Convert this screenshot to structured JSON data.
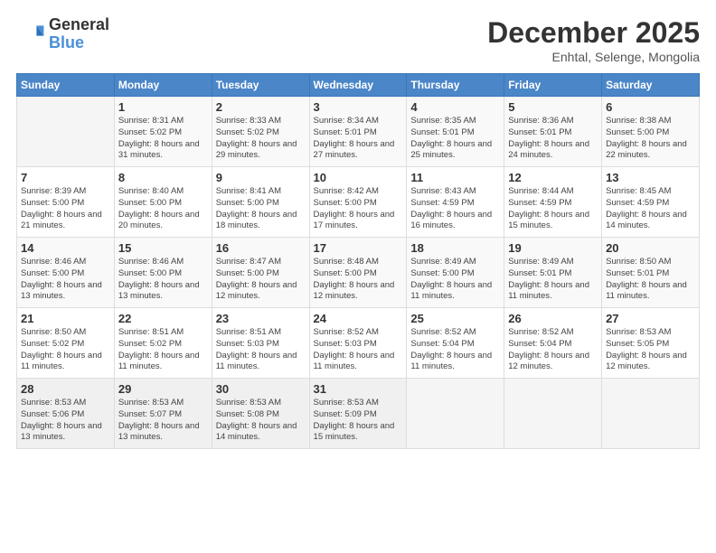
{
  "logo": {
    "general": "General",
    "blue": "Blue"
  },
  "header": {
    "month": "December 2025",
    "location": "Enhtal, Selenge, Mongolia"
  },
  "weekdays": [
    "Sunday",
    "Monday",
    "Tuesday",
    "Wednesday",
    "Thursday",
    "Friday",
    "Saturday"
  ],
  "weeks": [
    [
      {
        "day": "",
        "sunrise": "",
        "sunset": "",
        "daylight": ""
      },
      {
        "day": "1",
        "sunrise": "Sunrise: 8:31 AM",
        "sunset": "Sunset: 5:02 PM",
        "daylight": "Daylight: 8 hours and 31 minutes."
      },
      {
        "day": "2",
        "sunrise": "Sunrise: 8:33 AM",
        "sunset": "Sunset: 5:02 PM",
        "daylight": "Daylight: 8 hours and 29 minutes."
      },
      {
        "day": "3",
        "sunrise": "Sunrise: 8:34 AM",
        "sunset": "Sunset: 5:01 PM",
        "daylight": "Daylight: 8 hours and 27 minutes."
      },
      {
        "day": "4",
        "sunrise": "Sunrise: 8:35 AM",
        "sunset": "Sunset: 5:01 PM",
        "daylight": "Daylight: 8 hours and 25 minutes."
      },
      {
        "day": "5",
        "sunrise": "Sunrise: 8:36 AM",
        "sunset": "Sunset: 5:01 PM",
        "daylight": "Daylight: 8 hours and 24 minutes."
      },
      {
        "day": "6",
        "sunrise": "Sunrise: 8:38 AM",
        "sunset": "Sunset: 5:00 PM",
        "daylight": "Daylight: 8 hours and 22 minutes."
      }
    ],
    [
      {
        "day": "7",
        "sunrise": "Sunrise: 8:39 AM",
        "sunset": "Sunset: 5:00 PM",
        "daylight": "Daylight: 8 hours and 21 minutes."
      },
      {
        "day": "8",
        "sunrise": "Sunrise: 8:40 AM",
        "sunset": "Sunset: 5:00 PM",
        "daylight": "Daylight: 8 hours and 20 minutes."
      },
      {
        "day": "9",
        "sunrise": "Sunrise: 8:41 AM",
        "sunset": "Sunset: 5:00 PM",
        "daylight": "Daylight: 8 hours and 18 minutes."
      },
      {
        "day": "10",
        "sunrise": "Sunrise: 8:42 AM",
        "sunset": "Sunset: 5:00 PM",
        "daylight": "Daylight: 8 hours and 17 minutes."
      },
      {
        "day": "11",
        "sunrise": "Sunrise: 8:43 AM",
        "sunset": "Sunset: 4:59 PM",
        "daylight": "Daylight: 8 hours and 16 minutes."
      },
      {
        "day": "12",
        "sunrise": "Sunrise: 8:44 AM",
        "sunset": "Sunset: 4:59 PM",
        "daylight": "Daylight: 8 hours and 15 minutes."
      },
      {
        "day": "13",
        "sunrise": "Sunrise: 8:45 AM",
        "sunset": "Sunset: 4:59 PM",
        "daylight": "Daylight: 8 hours and 14 minutes."
      }
    ],
    [
      {
        "day": "14",
        "sunrise": "Sunrise: 8:46 AM",
        "sunset": "Sunset: 5:00 PM",
        "daylight": "Daylight: 8 hours and 13 minutes."
      },
      {
        "day": "15",
        "sunrise": "Sunrise: 8:46 AM",
        "sunset": "Sunset: 5:00 PM",
        "daylight": "Daylight: 8 hours and 13 minutes."
      },
      {
        "day": "16",
        "sunrise": "Sunrise: 8:47 AM",
        "sunset": "Sunset: 5:00 PM",
        "daylight": "Daylight: 8 hours and 12 minutes."
      },
      {
        "day": "17",
        "sunrise": "Sunrise: 8:48 AM",
        "sunset": "Sunset: 5:00 PM",
        "daylight": "Daylight: 8 hours and 12 minutes."
      },
      {
        "day": "18",
        "sunrise": "Sunrise: 8:49 AM",
        "sunset": "Sunset: 5:00 PM",
        "daylight": "Daylight: 8 hours and 11 minutes."
      },
      {
        "day": "19",
        "sunrise": "Sunrise: 8:49 AM",
        "sunset": "Sunset: 5:01 PM",
        "daylight": "Daylight: 8 hours and 11 minutes."
      },
      {
        "day": "20",
        "sunrise": "Sunrise: 8:50 AM",
        "sunset": "Sunset: 5:01 PM",
        "daylight": "Daylight: 8 hours and 11 minutes."
      }
    ],
    [
      {
        "day": "21",
        "sunrise": "Sunrise: 8:50 AM",
        "sunset": "Sunset: 5:02 PM",
        "daylight": "Daylight: 8 hours and 11 minutes."
      },
      {
        "day": "22",
        "sunrise": "Sunrise: 8:51 AM",
        "sunset": "Sunset: 5:02 PM",
        "daylight": "Daylight: 8 hours and 11 minutes."
      },
      {
        "day": "23",
        "sunrise": "Sunrise: 8:51 AM",
        "sunset": "Sunset: 5:03 PM",
        "daylight": "Daylight: 8 hours and 11 minutes."
      },
      {
        "day": "24",
        "sunrise": "Sunrise: 8:52 AM",
        "sunset": "Sunset: 5:03 PM",
        "daylight": "Daylight: 8 hours and 11 minutes."
      },
      {
        "day": "25",
        "sunrise": "Sunrise: 8:52 AM",
        "sunset": "Sunset: 5:04 PM",
        "daylight": "Daylight: 8 hours and 11 minutes."
      },
      {
        "day": "26",
        "sunrise": "Sunrise: 8:52 AM",
        "sunset": "Sunset: 5:04 PM",
        "daylight": "Daylight: 8 hours and 12 minutes."
      },
      {
        "day": "27",
        "sunrise": "Sunrise: 8:53 AM",
        "sunset": "Sunset: 5:05 PM",
        "daylight": "Daylight: 8 hours and 12 minutes."
      }
    ],
    [
      {
        "day": "28",
        "sunrise": "Sunrise: 8:53 AM",
        "sunset": "Sunset: 5:06 PM",
        "daylight": "Daylight: 8 hours and 13 minutes."
      },
      {
        "day": "29",
        "sunrise": "Sunrise: 8:53 AM",
        "sunset": "Sunset: 5:07 PM",
        "daylight": "Daylight: 8 hours and 13 minutes."
      },
      {
        "day": "30",
        "sunrise": "Sunrise: 8:53 AM",
        "sunset": "Sunset: 5:08 PM",
        "daylight": "Daylight: 8 hours and 14 minutes."
      },
      {
        "day": "31",
        "sunrise": "Sunrise: 8:53 AM",
        "sunset": "Sunset: 5:09 PM",
        "daylight": "Daylight: 8 hours and 15 minutes."
      },
      {
        "day": "",
        "sunrise": "",
        "sunset": "",
        "daylight": ""
      },
      {
        "day": "",
        "sunrise": "",
        "sunset": "",
        "daylight": ""
      },
      {
        "day": "",
        "sunrise": "",
        "sunset": "",
        "daylight": ""
      }
    ]
  ]
}
